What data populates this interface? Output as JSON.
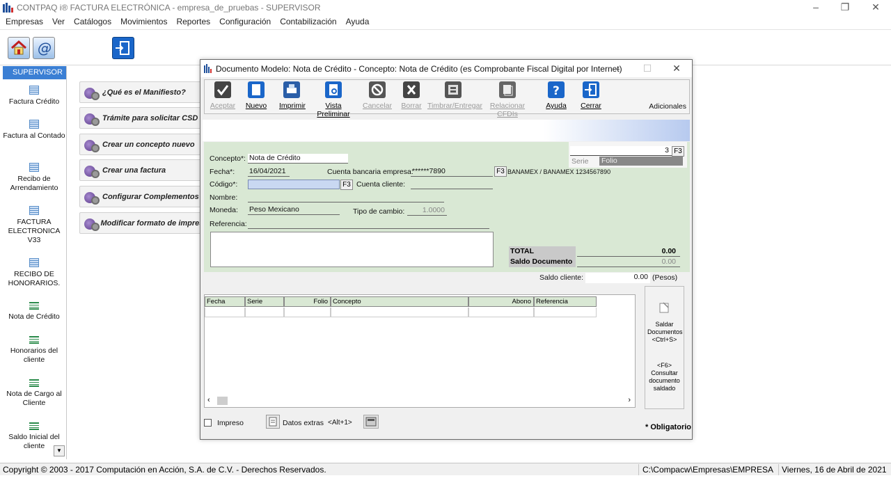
{
  "app": {
    "title": "CONTPAQ i® FACTURA ELECTRÓNICA  -  empresa_de_pruebas  -  SUPERVISOR",
    "logo_icon": "contpaq-logo-icon"
  },
  "menu": [
    "Empresas",
    "Ver",
    "Catálogos",
    "Movimientos",
    "Reportes",
    "Configuración",
    "Contabilización",
    "Ayuda"
  ],
  "sidebar": {
    "header": "SUPERVISOR",
    "items": [
      {
        "label": "Factura Crédito",
        "icon": "document-icon"
      },
      {
        "label": "Factura al Contado",
        "icon": "document-icon"
      },
      {
        "label": "Recibo de Arrendamiento",
        "icon": "document-icon"
      },
      {
        "label": "FACTURA ELECTRONICA V33",
        "icon": "document-icon"
      },
      {
        "label": "RECIBO DE HONORARIOS.",
        "icon": "document-icon"
      },
      {
        "label": "Nota de Crédito",
        "icon": "ledger-icon"
      },
      {
        "label": "Honorarios del cliente",
        "icon": "ledger-icon"
      },
      {
        "label": "Nota de Cargo al Cliente",
        "icon": "ledger-icon"
      },
      {
        "label": "Saldo Inicial del cliente",
        "icon": "ledger-icon"
      }
    ]
  },
  "tasks": [
    "¿Qué es el Manifiesto?",
    "Trámite para solicitar CSD",
    "Crear un concepto nuevo",
    "Crear una factura",
    "Configurar Complementos",
    "Modificar formato de impresión"
  ],
  "dialog": {
    "title": "Documento Modelo: Nota de Crédito - Concepto: Nota de Crédito (es Comprobante Fiscal Digital por Internet)",
    "tools": [
      {
        "label": "Aceptar",
        "icon": "check-icon",
        "enabled": false
      },
      {
        "label": "Nuevo",
        "icon": "new-document-icon",
        "enabled": true
      },
      {
        "label": "Imprimir",
        "icon": "printer-icon",
        "enabled": true
      },
      {
        "label": "Vista Preliminar",
        "icon": "preview-icon",
        "enabled": true
      },
      {
        "label": "Cancelar",
        "icon": "cancel-icon",
        "enabled": false
      },
      {
        "label": "Borrar",
        "icon": "delete-icon",
        "enabled": false
      },
      {
        "label": "Timbrar/Entregar",
        "icon": "stamp-icon",
        "enabled": false
      },
      {
        "label": "Relacionar CFDIs",
        "icon": "relate-icon",
        "enabled": false
      },
      {
        "label": "Ayuda",
        "icon": "help-icon",
        "enabled": true
      },
      {
        "label": "Cerrar",
        "icon": "exit-icon",
        "enabled": true
      }
    ],
    "adicionales": "Adicionales",
    "form": {
      "concepto_label": "Concepto*:",
      "concepto_value": "Nota de Crédito",
      "fecha_label": "Fecha*:",
      "fecha_value": "16/04/2021",
      "codigo_label": "Código*:",
      "codigo_value": "",
      "nombre_label": "Nombre:",
      "moneda_label": "Moneda:",
      "moneda_value": "Peso Mexicano",
      "referencia_label": "Referencia:",
      "cuenta_bancaria_label": "Cuenta bancaria empresa:",
      "cuenta_bancaria_value": "******7890",
      "banco_text": "BANAMEX / BANAMEX 1234567890",
      "cuenta_cliente_label": "Cuenta cliente:",
      "tipo_cambio_label": "Tipo de cambio:",
      "tipo_cambio_value": "1.0000",
      "f3": "F3",
      "folio_value": "3",
      "serie_label": "Serie",
      "folio_label": "Folio"
    },
    "totals": {
      "total_label": "TOTAL",
      "total_value": "0.00",
      "saldo_label": "Saldo Documento",
      "saldo_value": "0.00"
    },
    "saldo_cliente": {
      "label": "Saldo cliente:",
      "value": "0.00",
      "unit": "(Pesos)"
    },
    "grid": {
      "columns": [
        "Fecha",
        "Serie",
        "Folio",
        "Concepto",
        "Abono",
        "Referencia"
      ]
    },
    "side_actions": {
      "saldar": "Saldar Documentos <Ctrl+S>",
      "consultar": "<F6> Consultar documento saldado"
    },
    "footer": {
      "impreso": "Impreso",
      "datos_extras": "Datos extras",
      "datos_extras_shortcut": "<Alt+1>",
      "obligatorio": "* Obligatorio"
    }
  },
  "status": {
    "copyright": "Copyright © 2003 - 2017 Computación en Acción, S.A. de C.V. - Derechos Reservados.",
    "path": "C:\\Compacw\\Empresas\\EMPRESA",
    "date": "Viernes, 16 de Abril de 2021"
  }
}
